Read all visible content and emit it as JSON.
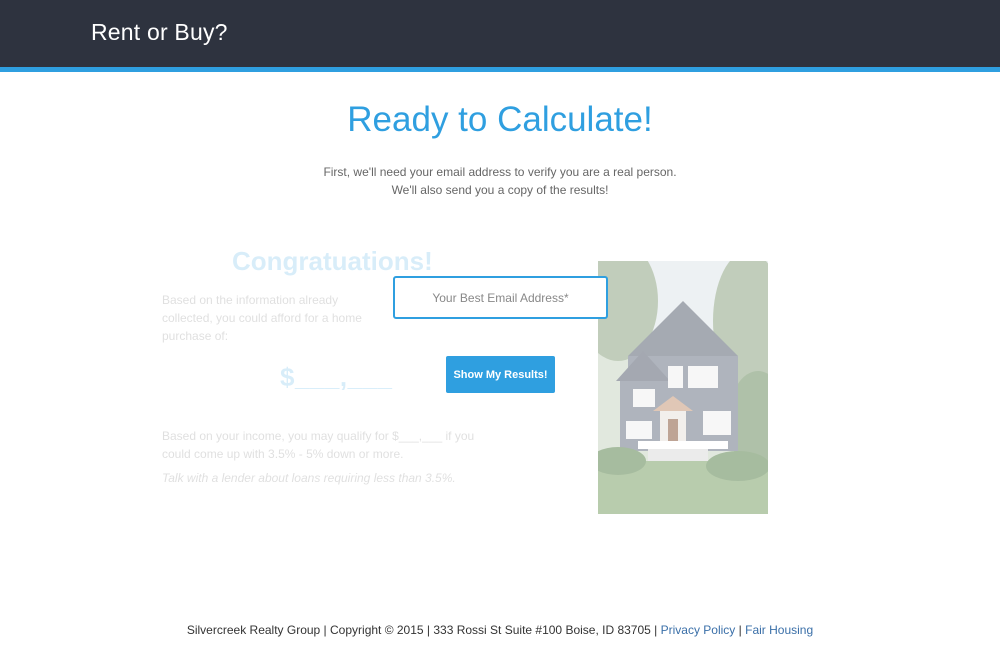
{
  "header": {
    "brand": "Rent or Buy?"
  },
  "hero": {
    "title": "Ready to Calculate!",
    "subtitle_line1": "First, we'll need your email address to verify you are a real person.",
    "subtitle_line2": "We'll also send you a copy of the results!"
  },
  "results_preview": {
    "congrats": "Congratuations!",
    "para1": "Based on the information already collected, you could afford for a home purchase of:",
    "amount": "$___,___",
    "para2": "Based on your income, you may qualify for $___,___ if you could come up with 3.5% - 5% down or more.",
    "para3": "Talk with a lender about loans requiring less than 3.5%."
  },
  "form": {
    "email_placeholder": "Your Best Email Address*",
    "submit_label": "Show My Results!"
  },
  "footer": {
    "text": "Silvercreek Realty Group | Copyright © 2015 | 333 Rossi St Suite #100 Boise, ID 83705 | ",
    "privacy_link": "Privacy Policy",
    "separator": " | ",
    "fair_housing_link": "Fair Housing"
  },
  "colors": {
    "accent": "#2f9fe0",
    "header_bg": "#2e333f"
  }
}
